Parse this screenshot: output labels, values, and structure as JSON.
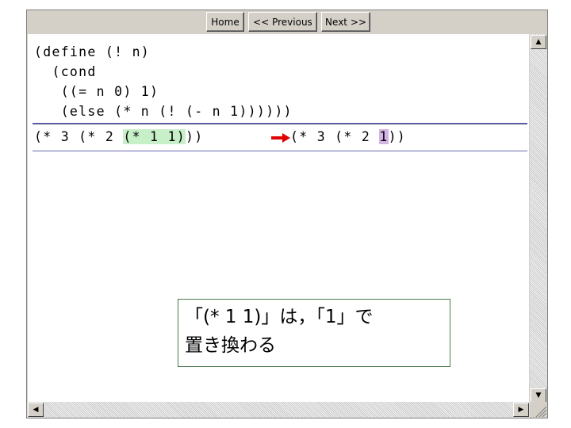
{
  "nav": {
    "home": "Home",
    "previous": "<< Previous",
    "next": "Next >>"
  },
  "code": {
    "line1": "(define (! n)",
    "line2": "  (cond",
    "line3": "   ((= n 0) 1)",
    "line4": "   (else (* n (! (- n 1))))))"
  },
  "step": {
    "before_prefix": "(* 3 (* 2 ",
    "before_highlight": "(* 1 1)",
    "before_suffix": "))",
    "after_prefix": "(* 3 (* 2 ",
    "after_highlight": "1",
    "after_suffix": "))"
  },
  "note": {
    "line1": "「(* 1 1)」は，「1」で",
    "line2": "置き換わる"
  },
  "colors": {
    "highlight_before": "#c8f0c8",
    "highlight_after": "#d2b4e6",
    "arrow": "#e00000",
    "rule": "#5a5aa0"
  },
  "icons": {
    "scroll_up": "triangle-up-icon",
    "scroll_down": "triangle-down-icon",
    "scroll_left": "triangle-left-icon",
    "scroll_right": "triangle-right-icon",
    "arrow": "right-arrow-icon"
  }
}
